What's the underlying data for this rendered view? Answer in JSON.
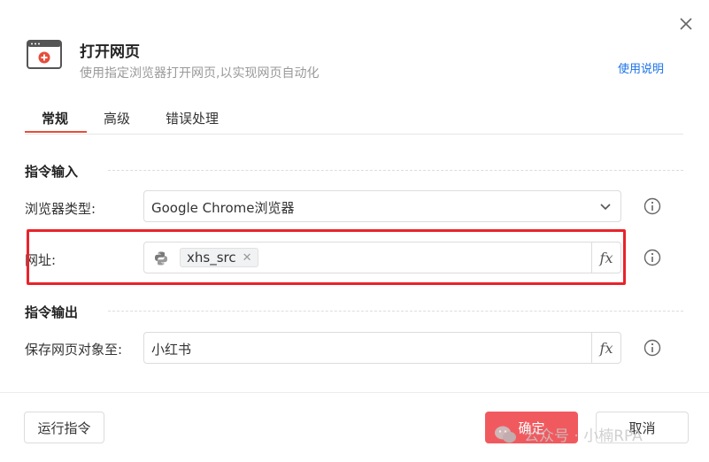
{
  "header": {
    "title": "打开网页",
    "subtitle": "使用指定浏览器打开网页,以实现网页自动化",
    "help_link": "使用说明"
  },
  "tabs": [
    {
      "label": "常规",
      "active": true
    },
    {
      "label": "高级",
      "active": false
    },
    {
      "label": "错误处理",
      "active": false
    }
  ],
  "input_section": {
    "title": "指令输入",
    "browser_type": {
      "label": "浏览器类型:",
      "value": "Google Chrome浏览器"
    },
    "url": {
      "label": "网址:",
      "variable": "xhs_src"
    }
  },
  "output_section": {
    "title": "指令输出",
    "save_object": {
      "label": "保存网页对象至:",
      "value": "小红书"
    }
  },
  "fx_label": "fx",
  "footer": {
    "run_button": "运行指令",
    "ok_button": "确定",
    "cancel_button": "取消"
  },
  "watermark": "公众号 · 小楠RPA",
  "colors": {
    "accent_red": "#e74c3c",
    "ok_button": "#f05a5f",
    "link_blue": "#1a73e8",
    "highlight_box": "#e8232b"
  }
}
